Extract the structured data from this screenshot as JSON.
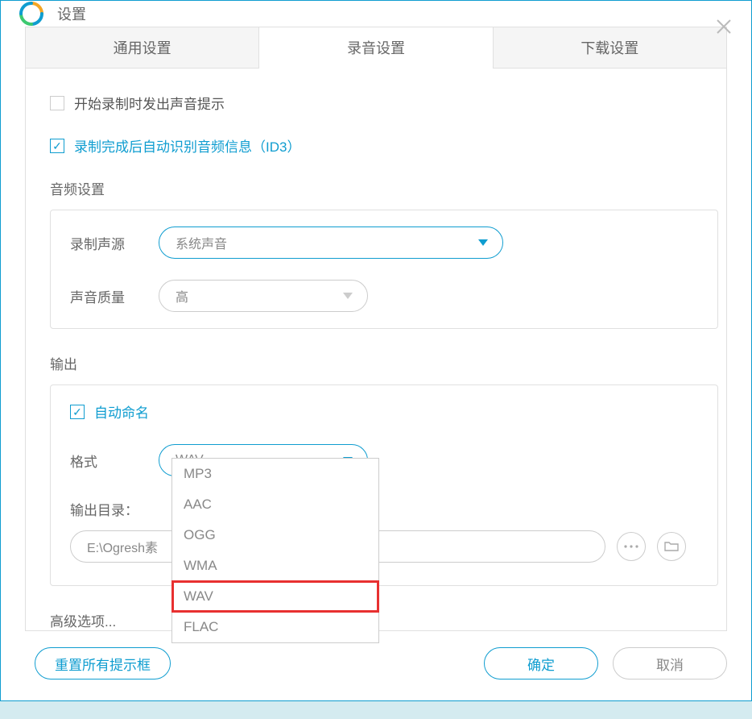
{
  "window": {
    "title": "设置"
  },
  "tabs": {
    "general": "通用设置",
    "recording": "录音设置",
    "download": "下载设置"
  },
  "checkboxes": {
    "sound_on_start": "开始录制时发出声音提示",
    "auto_id3": "录制完成后自动识别音频信息（ID3）"
  },
  "audio_settings": {
    "section_label": "音频设置",
    "source_label": "录制声源",
    "source_value": "系统声音",
    "quality_label": "声音质量",
    "quality_value": "高"
  },
  "output": {
    "section_label": "输出",
    "auto_name": "自动命名",
    "format_label": "格式",
    "format_value": "WAV",
    "output_dir_label": "输出目录：",
    "output_dir_value": "E:\\Ogresh素",
    "format_options": [
      "MP3",
      "AAC",
      "OGG",
      "WMA",
      "WAV",
      "FLAC"
    ]
  },
  "advanced": "高级选项...",
  "footer": {
    "reset": "重置所有提示框",
    "ok": "确定",
    "cancel": "取消"
  }
}
